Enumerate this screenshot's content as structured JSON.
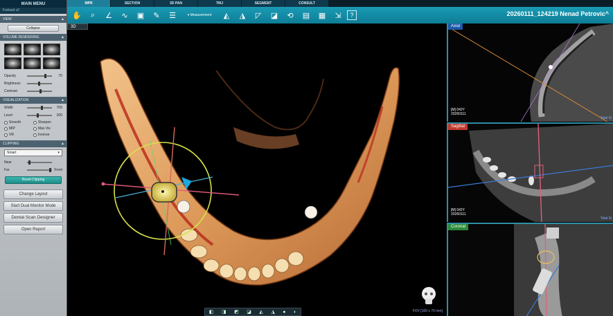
{
  "sidebar": {
    "main_menu": "MAIN MENU",
    "sub_label": "Forkard v2",
    "sections": {
      "view": "VIEW",
      "volume_rendering": "VOLUME RENDERING",
      "visualization": "VISUALIZATION",
      "clipping": "CLIPPING"
    },
    "collapse_btn": "Collapse",
    "sliders_vr": [
      {
        "label": "Opacity",
        "value": "70"
      },
      {
        "label": "Brightness",
        "value": ""
      },
      {
        "label": "Contrast",
        "value": ""
      }
    ],
    "sliders_vis": [
      {
        "label": "Width",
        "value": "700"
      },
      {
        "label": "Level",
        "value": "200"
      }
    ],
    "checks": [
      "Smooth",
      "Sharpen",
      "MIP",
      "Max Vis",
      "VR",
      "Inverse"
    ],
    "clip_select": "Smart",
    "clip_sliders": [
      {
        "label": "Near",
        "value": ""
      },
      {
        "label": "Far",
        "value": "Front"
      }
    ],
    "reset_clipping": "Reset Clipping",
    "change_layout": "Change Layout",
    "dual_monitor": "Start Dual Monitor Mode",
    "dental_scan": "Dental Scan Designer",
    "open_report": "Open Report"
  },
  "tabs": [
    "MPR",
    "SECTION",
    "3D PAN",
    "TMJ",
    "SEGMENT",
    "CONSULT"
  ],
  "active_tab": "MPR",
  "toolbar": {
    "measurement_label": "Measurement",
    "case_title": "20260111_124219  Nenad Petrovic^"
  },
  "view3d": {
    "label": "3D",
    "fov": "FOV [100 x 70 mm]"
  },
  "panels": {
    "axial": {
      "label": "Axial",
      "info": [
        "[M] 042Y",
        "20260111"
      ],
      "thickness": "Total Si"
    },
    "sagittal": {
      "label": "Sagittal",
      "info": [
        "[M] 042Y",
        "20260111"
      ],
      "thickness": "Total Si"
    },
    "coronal": {
      "label": "Coronal",
      "info": [],
      "thickness": ""
    }
  },
  "colors": {
    "accent": "#1a9bb5",
    "axial": "#1d5aa8",
    "sagittal": "#c0392b",
    "coronal": "#2c8a3a",
    "bone": "#e8b070",
    "crosshair_ring": "#d8e34a"
  }
}
